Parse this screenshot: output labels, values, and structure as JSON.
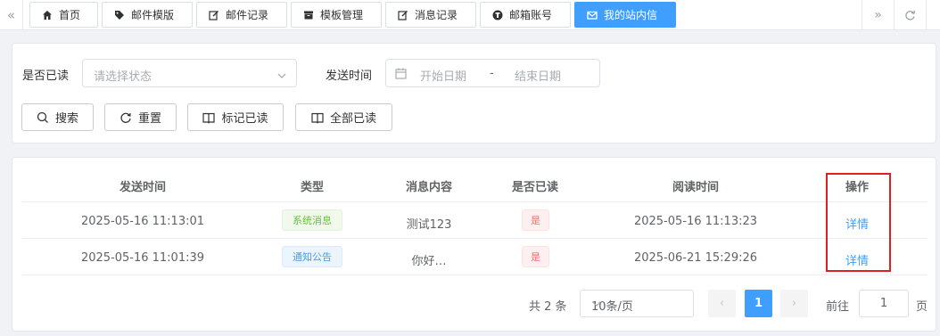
{
  "tabs": [
    {
      "label": "首页",
      "icon": "home-icon"
    },
    {
      "label": "邮件模版",
      "icon": "tag-icon"
    },
    {
      "label": "邮件记录",
      "icon": "edit-icon"
    },
    {
      "label": "模板管理",
      "icon": "folder-icon"
    },
    {
      "label": "消息记录",
      "icon": "edit-icon"
    },
    {
      "label": "邮箱账号",
      "icon": "account-icon"
    },
    {
      "label": "我的站内信",
      "icon": "mail-icon",
      "active": true
    }
  ],
  "filter": {
    "read_label": "是否已读",
    "read_placeholder": "请选择状态",
    "time_label": "发送时间",
    "start_placeholder": "开始日期",
    "range_separator": "-",
    "end_placeholder": "结束日期"
  },
  "buttons": {
    "search": "搜索",
    "reset": "重置",
    "mark_read": "标记已读",
    "all_read": "全部已读"
  },
  "table": {
    "columns": [
      "发送时间",
      "类型",
      "消息内容",
      "是否已读",
      "阅读时间",
      "操作"
    ],
    "rows": [
      {
        "send_time": "2025-05-16 11:13:01",
        "type": "系统消息",
        "type_color": "green",
        "content": "测试123",
        "read": "是",
        "read_time": "2025-05-16 11:13:23",
        "action": "详情"
      },
      {
        "send_time": "2025-05-16 11:01:39",
        "type": "通知公告",
        "type_color": "blue",
        "content": "你好…",
        "read": "是",
        "read_time": "2025-06-21 15:29:26",
        "action": "详情"
      }
    ]
  },
  "pagination": {
    "total": "共 2 条",
    "page_size": "10条/页",
    "current_page": "1",
    "goto_label": "前往",
    "goto_value": "1",
    "page_suffix": "页"
  },
  "colors": {
    "primary": "#409eff",
    "success": "#67c23a",
    "danger": "#f56c6c",
    "highlight": "#e02020"
  }
}
